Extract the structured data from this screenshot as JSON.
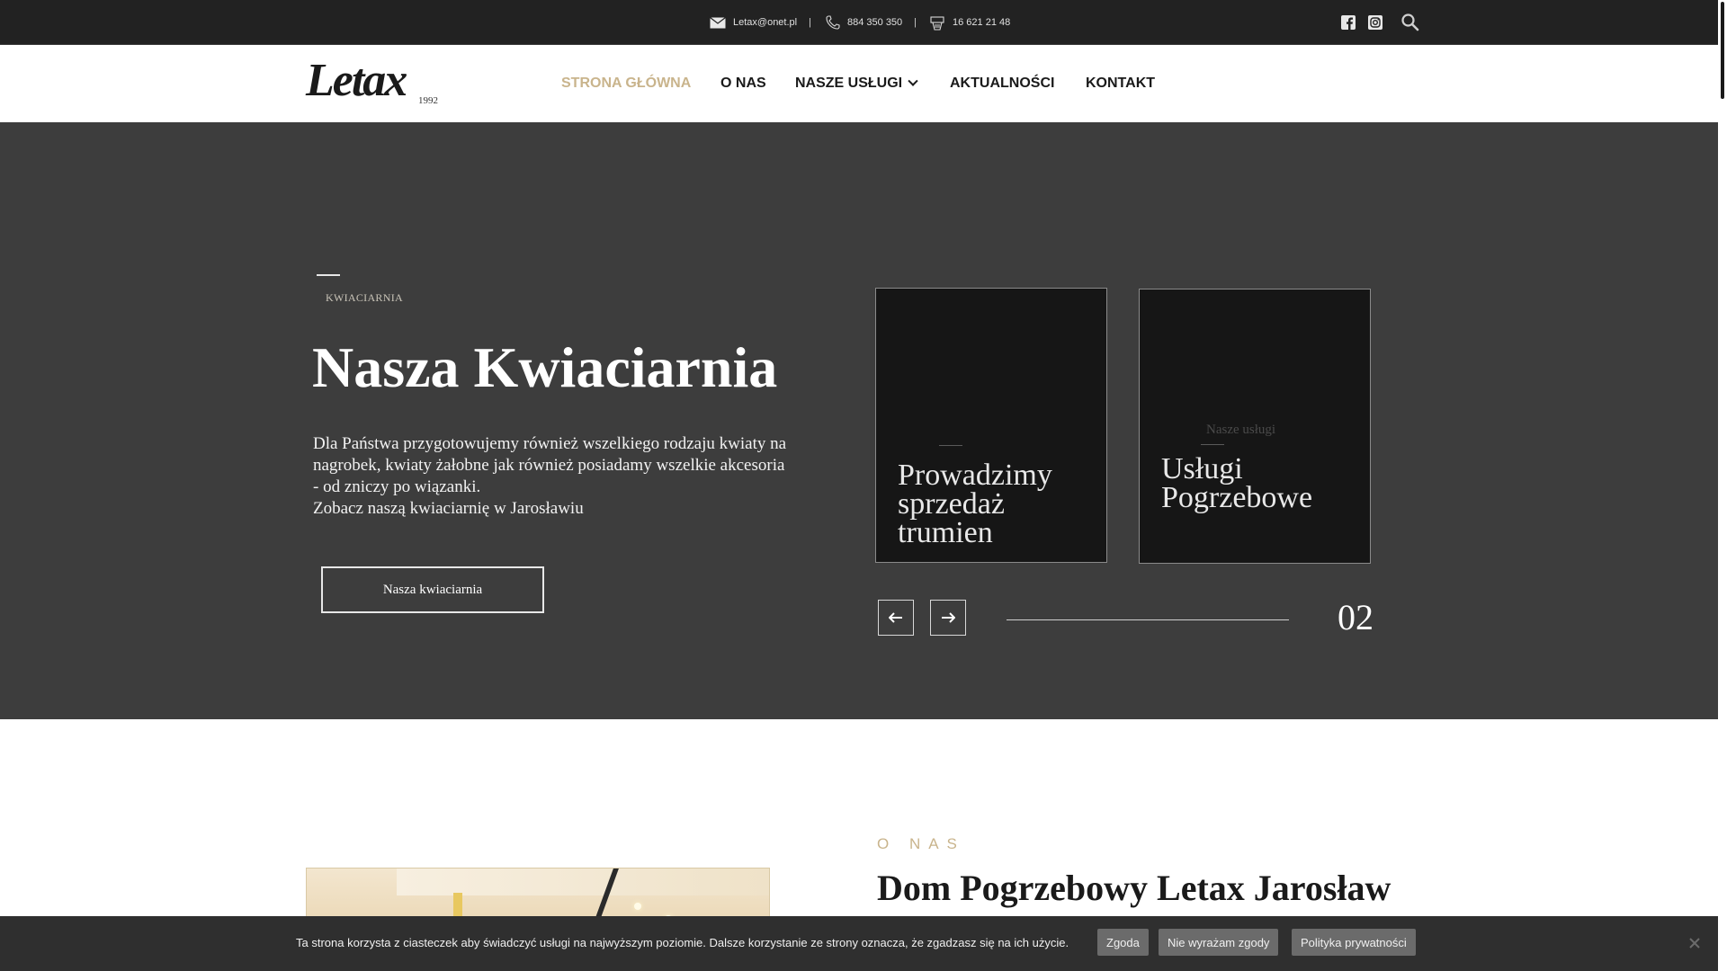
{
  "topbar": {
    "email": "Letax@onet.pl",
    "phone1": "884 350 350",
    "phone2": "16 621 21 48",
    "separator": "|",
    "icons": [
      "mail-icon",
      "phone-icon",
      "fax-icon",
      "facebook-icon",
      "instagram-icon",
      "search-icon"
    ]
  },
  "logo": {
    "text": "Letax",
    "year": "1992"
  },
  "nav": {
    "items": [
      {
        "label": "STRONA GŁÓWNA",
        "active": true
      },
      {
        "label": "O NAS"
      },
      {
        "label": "NASZE USŁUGI",
        "has_dropdown": true
      },
      {
        "label": "AKTUALNOŚCI"
      },
      {
        "label": "KONTAKT"
      }
    ]
  },
  "hero": {
    "kicker": "KWIACIARNIA",
    "title": "Nasza Kwiaciarnia",
    "description_lines": [
      "Dla Państwa przygotowujemy również wszelkiego rodzaju kwiaty na",
      "nagrobek, kwiaty żałobne jak również posiadamy wszelkie akcesoria",
      "- od zniczy po wiązanki.",
      "Zobacz naszą kwiaciarnię w Jarosławiu"
    ],
    "button_label": "Nasza kwiaciarnia",
    "cards": [
      {
        "title_lines": [
          "Prowadzimy",
          "sprzedaż",
          "trumien"
        ]
      },
      {
        "kicker": "Nasze usługi",
        "title_lines": [
          "Usługi",
          "Pogrzebowe"
        ]
      }
    ],
    "slide_counter": "02"
  },
  "about": {
    "kicker": "O NAS",
    "title": "Dom Pogrzebowy Letax Jarosław"
  },
  "cookie": {
    "text": "Ta strona korzysta z ciasteczek aby świadczyć usługi na najwyższym poziomie. Dalsze korzystanie ze strony oznacza, że zgadzasz się na ich użycie.",
    "accept_label": "Zgoda",
    "decline_label": "Nie wyrażam zgody",
    "policy_label": "Polityka prywatności"
  },
  "colors": {
    "topbar_bg": "#222222",
    "hero_bg": "#3d3d3d",
    "accent_gold": "#c9b48c",
    "cookie_bg": "#2f2f2f"
  }
}
